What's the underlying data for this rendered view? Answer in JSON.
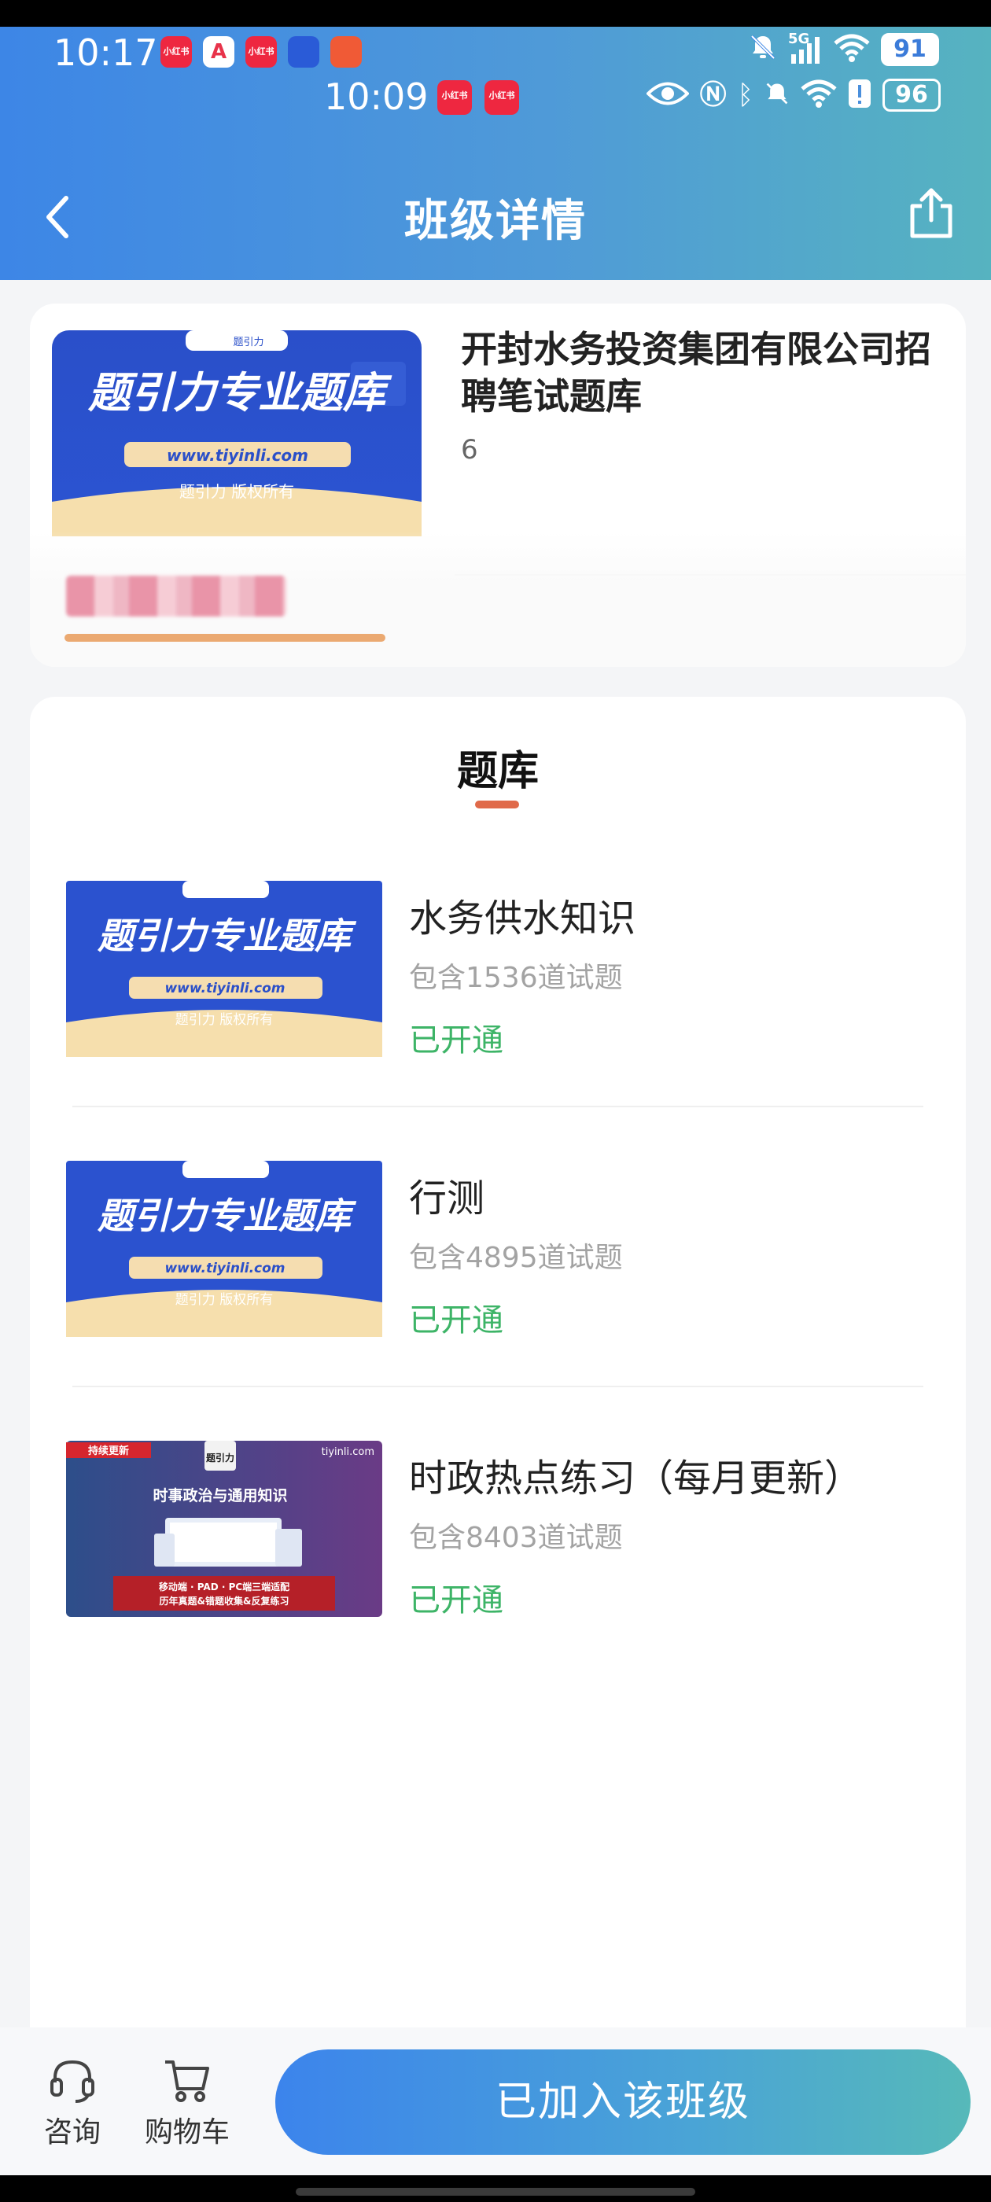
{
  "status_bar": {
    "time_primary": "10:17",
    "time_secondary": "10:09",
    "network": "5G",
    "battery_primary": "91",
    "battery_secondary": "96",
    "app_icons": [
      {
        "name": "xiaohongshu-icon",
        "text": "小红书"
      },
      {
        "name": "app-a-icon",
        "text": "A"
      },
      {
        "name": "xiaohongshu-icon",
        "text": "小红书"
      },
      {
        "name": "app-shield-icon",
        "text": ""
      },
      {
        "name": "app-circle-icon",
        "text": ""
      }
    ]
  },
  "nav": {
    "title": "班级详情"
  },
  "course": {
    "title": "开封水务投资集团有限公司招聘笔试题库",
    "count": "6"
  },
  "cover": {
    "brand_top": "题引力",
    "headline": "题引力专业题库",
    "url": "www.tiyinli.com",
    "copyright": "题引力 版权所有"
  },
  "cover_alt": {
    "badge": "持续更新",
    "site": "tiyinli.com",
    "logo": "题引力",
    "headline": "时事政治与通用知识",
    "bar_line1": "移动端 · PAD · PC端三端适配",
    "bar_line2": "历年真题&错题收集&反复练习"
  },
  "bank": {
    "heading": "题库",
    "items": [
      {
        "name": "水务供水知识",
        "sub": "包含1536道试题",
        "status": "已开通"
      },
      {
        "name": "行测",
        "sub": "包含4895道试题",
        "status": "已开通"
      },
      {
        "name": "时政热点练习（每月更新）",
        "sub": "包含8403道试题",
        "status": "已开通"
      }
    ]
  },
  "bottom": {
    "consult": "咨询",
    "cart": "购物车",
    "join": "已加入该班级"
  },
  "colors": {
    "header_start": "#3d86e6",
    "header_end": "#56b3c0",
    "status_green": "#3db467",
    "accent_orange": "#e06a4a"
  }
}
